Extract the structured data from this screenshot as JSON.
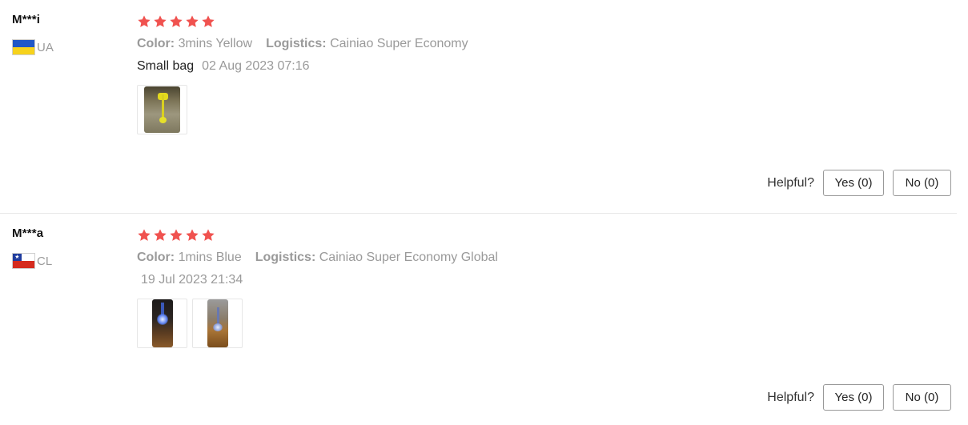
{
  "colors": {
    "star": "#f0524f",
    "muted": "#9a9a9a"
  },
  "reviews": [
    {
      "user": "M***i",
      "country": "UA",
      "flag": {
        "top": "#1f57c7",
        "bottom": "#f6d21c",
        "canton": ""
      },
      "stars": 5,
      "color_label": "Color:",
      "color_value": "3mins Yellow",
      "logistics_label": "Logistics:",
      "logistics_value": "Cainiao Super Economy",
      "text": "Small bag",
      "date": "02 Aug 2023 07:16",
      "images": [
        "review-photo-1"
      ],
      "helpful_label": "Helpful?",
      "yes_label": "Yes (0)",
      "no_label": "No (0)"
    },
    {
      "user": "M***a",
      "country": "CL",
      "flag": {
        "top": "#ffffff",
        "bottom": "#d52b1e",
        "canton": "#1f3c9e"
      },
      "stars": 5,
      "color_label": "Color:",
      "color_value": "1mins Blue",
      "logistics_label": "Logistics:",
      "logistics_value": "Cainiao Super Economy Global",
      "text": "",
      "date": "19 Jul 2023 21:34",
      "images": [
        "review-photo-1",
        "review-photo-2"
      ],
      "helpful_label": "Helpful?",
      "yes_label": "Yes (0)",
      "no_label": "No (0)"
    }
  ]
}
